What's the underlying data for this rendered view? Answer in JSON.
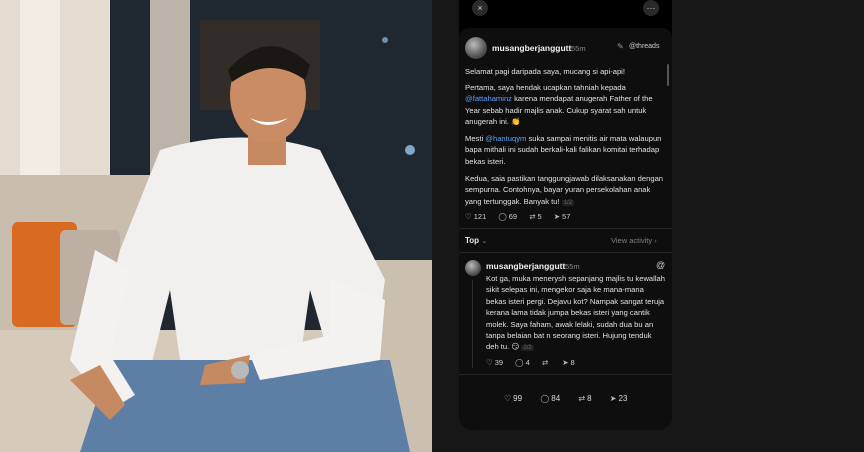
{
  "topbar": {
    "close_icon": "×",
    "more_icon": "···"
  },
  "post": {
    "username": "musangberjanggutt",
    "time": "55m",
    "threads_label": "@threads",
    "greeting": "Selamat pagi daripada saya, mucang si api-api!",
    "p1_a": "Pertama, saya hendak ucapkan tahniah kepada ",
    "p1_mention": "@fattahaminz",
    "p1_b": " karena mendapat anugerah Father of the Year sebab hadir majlis anak. Cukup syarat sah untuk anugerah ini. 👏",
    "p2_a": "Mesti ",
    "p2_mention": "@hantuqym",
    "p2_b": " suka sampai menitis air mata walaupun bapa mithali ini sudah berkali-kali falikan komitai terhadap bekas isteri.",
    "p3": "Kedua, saia pastikan tanggungjawab dilaksanakan dengan sempurna. Contohnya, bayar yuran persekolahan anak yang tertunggak. Banyak tu!",
    "page": "1/2",
    "likes": "121",
    "comments": "69",
    "reposts": "5",
    "shares": "57"
  },
  "sort": {
    "label": "Top",
    "view_activity": "View activity"
  },
  "reply": {
    "username": "musangberjanggutt",
    "time": "55m",
    "text": "Kot ga, muka menerysh sepanjang majlis tu kewallah sikit selepas ini, mengekor saja ke mana-mana bekas isteri pergi. Dejavu kot? Nampak sangat teruja kerana lama tidak jumpa bekas isteri yang cantik molek. Saya faham, awak lelaki, sudah dua bu an tanpa belaian bat n seorang isteri. Hujung tenduk deh tu. 😏",
    "page": "2/2",
    "likes": "39",
    "comments": "4",
    "shares": "8"
  },
  "bottom": {
    "likes": "99",
    "comments": "84",
    "reposts": "8",
    "shares": "23"
  },
  "colors": {
    "mention": "#5aa0ff",
    "background": "#000000"
  },
  "icons": [
    "close-icon",
    "more-icon",
    "edit-icon",
    "threads-icon",
    "heart-icon",
    "comment-icon",
    "repost-icon",
    "share-icon",
    "chevron-down-icon",
    "chevron-right-icon"
  ]
}
